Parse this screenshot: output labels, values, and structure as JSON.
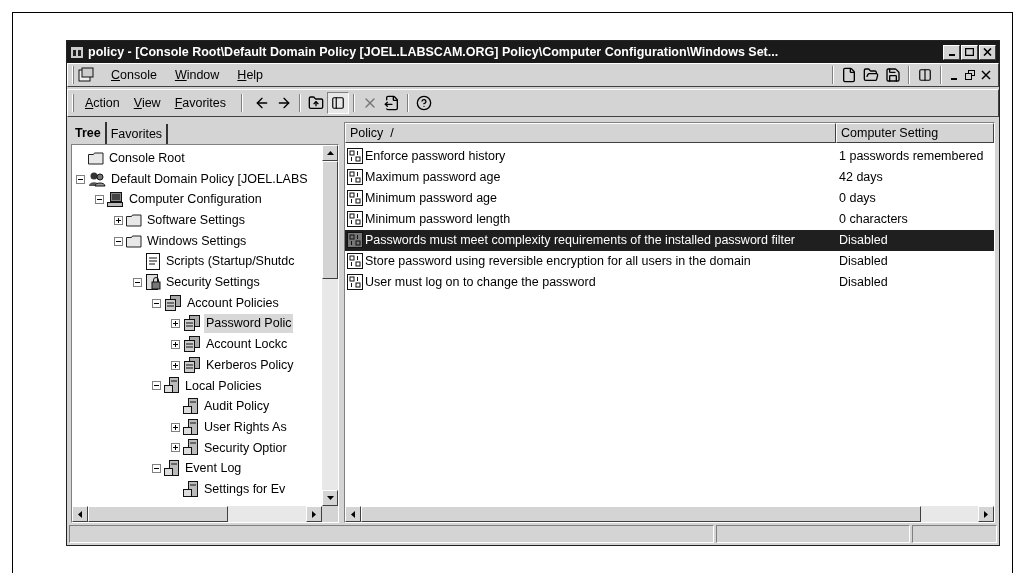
{
  "window": {
    "title": "policy - [Console Root\\Default Domain Policy [JOEL.LABSCAM.ORG] Policy\\Computer Configuration\\Windows Set..."
  },
  "menu": [
    "Console",
    "Window",
    "Help"
  ],
  "action_menu": [
    "Action",
    "View",
    "Favorites"
  ],
  "tabs": [
    {
      "label": "Tree",
      "selected": true
    },
    {
      "label": "Favorites",
      "selected": false
    }
  ],
  "tree": [
    {
      "label": "Console Root",
      "kind": "folder",
      "selected": false
    },
    {
      "label": "Default Domain Policy [JOEL.LABS",
      "kind": "domain",
      "selected": false,
      "expanded": true,
      "children": [
        {
          "label": "Computer Configuration",
          "kind": "computer",
          "selected": false,
          "expanded": true,
          "children": [
            {
              "label": "Software Settings",
              "kind": "folder",
              "selected": false,
              "expanded": false
            },
            {
              "label": "Windows Settings",
              "kind": "folder",
              "selected": false,
              "expanded": true,
              "children": [
                {
                  "label": "Scripts (Startup/Shutdc",
                  "kind": "script",
                  "selected": false
                },
                {
                  "label": "Security Settings",
                  "kind": "security",
                  "selected": false,
                  "expanded": true,
                  "children": [
                    {
                      "label": "Account Policies",
                      "kind": "group",
                      "selected": false,
                      "expanded": true,
                      "children": [
                        {
                          "label": "Password Polic",
                          "kind": "group",
                          "selected": true,
                          "expanded": false
                        },
                        {
                          "label": "Account Lockc",
                          "kind": "group",
                          "selected": false,
                          "expanded": false
                        },
                        {
                          "label": "Kerberos Policy",
                          "kind": "group",
                          "selected": false,
                          "expanded": false
                        }
                      ]
                    },
                    {
                      "label": "Local Policies",
                      "kind": "server",
                      "selected": false,
                      "expanded": true,
                      "children": [
                        {
                          "label": "Audit Policy",
                          "kind": "server",
                          "selected": false
                        },
                        {
                          "label": "User Rights As",
                          "kind": "server",
                          "selected": false,
                          "expanded": false
                        },
                        {
                          "label": "Security Optior",
                          "kind": "server",
                          "selected": false,
                          "expanded": false
                        }
                      ]
                    },
                    {
                      "label": "Event Log",
                      "kind": "server",
                      "selected": false,
                      "expanded": true,
                      "children": [
                        {
                          "label": "Settings for Ev",
                          "kind": "server",
                          "selected": false
                        }
                      ]
                    }
                  ]
                }
              ]
            }
          ]
        }
      ]
    }
  ],
  "list": {
    "columns": [
      "Policy  /",
      "Computer Setting"
    ],
    "rows": [
      {
        "policy": "Enforce password history",
        "setting": "1 passwords remembered",
        "selected": false
      },
      {
        "policy": "Maximum password age",
        "setting": "42 days",
        "selected": false
      },
      {
        "policy": "Minimum password age",
        "setting": "0 days",
        "selected": false
      },
      {
        "policy": "Minimum password length",
        "setting": "0 characters",
        "selected": false
      },
      {
        "policy": "Passwords must meet complexity requirements of the installed password filter",
        "setting": "Disabled",
        "selected": true
      },
      {
        "policy": "Store password using reversible encryption for all users in the domain",
        "setting": "Disabled",
        "selected": false
      },
      {
        "policy": "User must log on to change the password",
        "setting": "Disabled",
        "selected": false
      }
    ]
  }
}
